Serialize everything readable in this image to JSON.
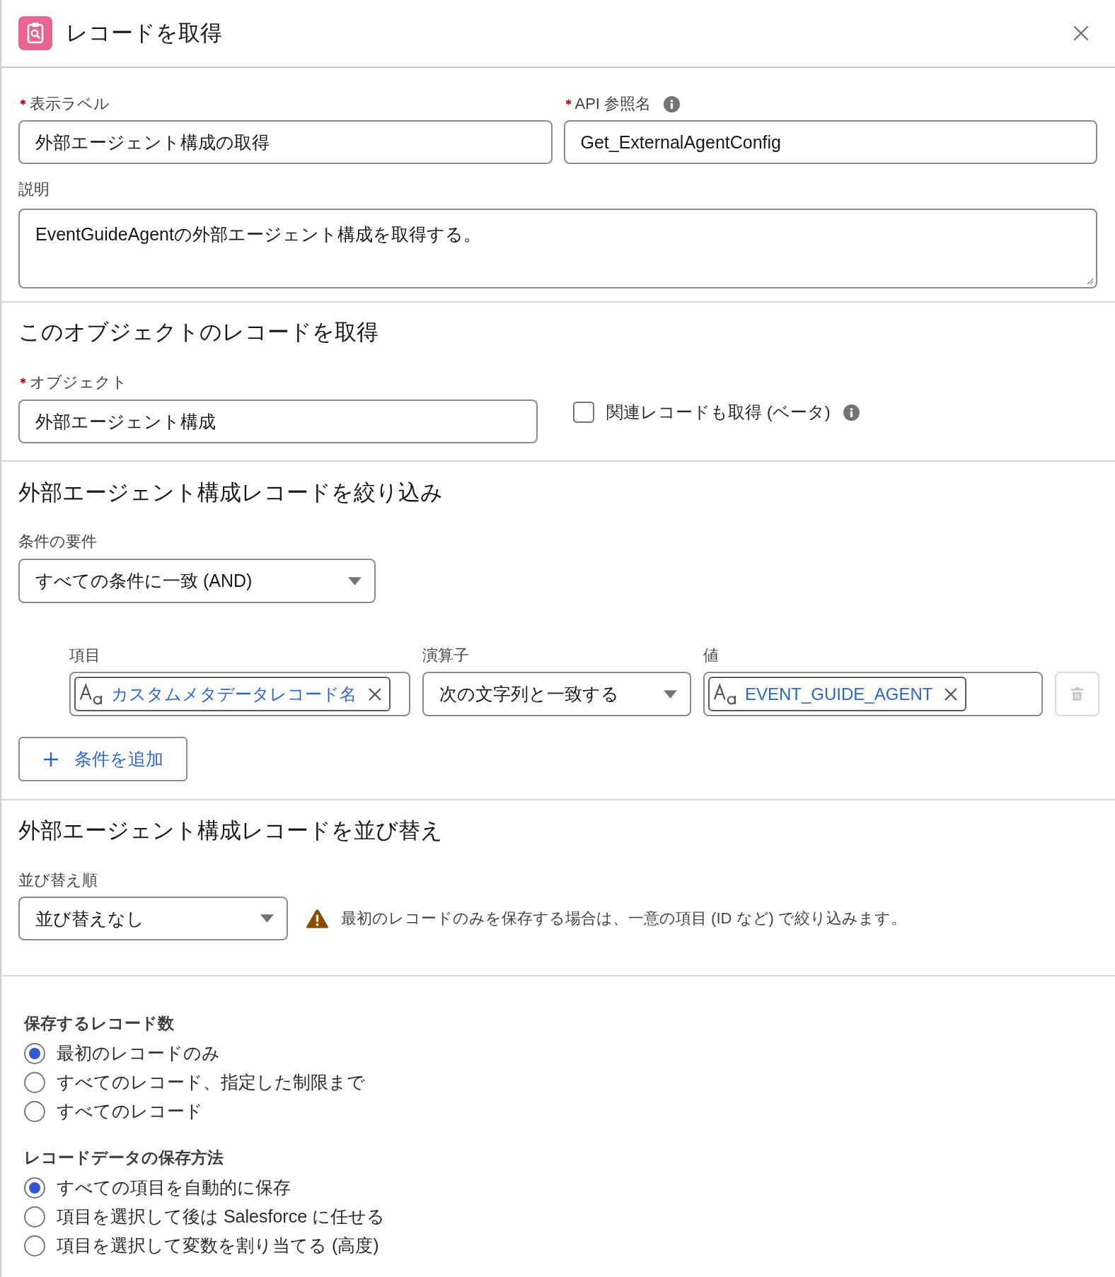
{
  "header": {
    "title": "レコードを取得"
  },
  "basics": {
    "fields": [
      {
        "label": "表示ラベル",
        "required": true,
        "info": false,
        "value": "外部エージェント構成の取得"
      },
      {
        "label": "API 参照名",
        "required": true,
        "info": true,
        "value": "Get_ExternalAgentConfig"
      }
    ],
    "description": {
      "label": "説明",
      "required": false,
      "value": "EventGuideAgentの外部エージェント構成を取得する。"
    }
  },
  "object_section": {
    "heading": "このオブジェクトのレコードを取得",
    "object": {
      "label": "オブジェクト",
      "required": true,
      "value": "外部エージェント構成"
    },
    "related_records": {
      "label": "関連レコードも取得 (ベータ)",
      "checked": false,
      "info": true
    }
  },
  "filter_section": {
    "heading": "外部エージェント構成レコードを絞り込み",
    "requirement": {
      "label": "条件の要件",
      "value": "すべての条件に一致 (AND)"
    },
    "columns": [
      "項目",
      "演算子",
      "値"
    ],
    "conditions": [
      {
        "field": "カスタムメタデータレコード名",
        "operator": "次の文字列と一致する",
        "value": "EVENT_GUIDE_AGENT",
        "delete_disabled": true
      }
    ],
    "add_button": "条件を追加"
  },
  "sort_section": {
    "heading": "外部エージェント構成レコードを並び替え",
    "sort_order": {
      "label": "並び替え順",
      "value": "並び替えなし"
    },
    "warning": "最初のレコードのみを保存する場合は、一意の項目 (ID など) で絞り込みます。"
  },
  "storage": {
    "groups": [
      {
        "title": "保存するレコード数",
        "options": [
          {
            "label": "最初のレコードのみ",
            "selected": true
          },
          {
            "label": "すべてのレコード、指定した制限まで",
            "selected": false
          },
          {
            "label": "すべてのレコード",
            "selected": false
          }
        ]
      },
      {
        "title": "レコードデータの保存方法",
        "options": [
          {
            "label": "すべての項目を自動的に保存",
            "selected": true
          },
          {
            "label": "項目を選択して後は Salesforce に任せる",
            "selected": false
          },
          {
            "label": "項目を選択して変数を割り当てる (高度)",
            "selected": false
          }
        ]
      }
    ]
  }
}
